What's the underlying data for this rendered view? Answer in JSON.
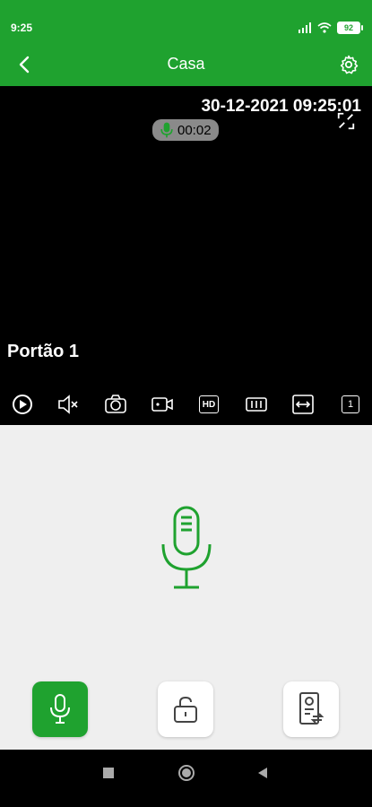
{
  "status_bar": {
    "time": "9:25",
    "battery": "92"
  },
  "header": {
    "title": "Casa"
  },
  "video": {
    "timestamp": "30-12-2021 09:25:01",
    "recording_time": "00:02",
    "camera_name": "Portão 1"
  },
  "toolbar": {
    "icons": [
      "play-icon",
      "mute-icon",
      "snapshot-icon",
      "record-video-icon",
      "hd-icon",
      "stream-icon",
      "fit-icon",
      "channel-icon"
    ],
    "channel_number": "1",
    "hd_label": "HD"
  },
  "colors": {
    "brand_green": "#1fa22f",
    "video_bg": "#000000",
    "panel_bg": "#efefef"
  },
  "actions": {
    "items": [
      "talk",
      "unlock",
      "switch-device"
    ]
  }
}
